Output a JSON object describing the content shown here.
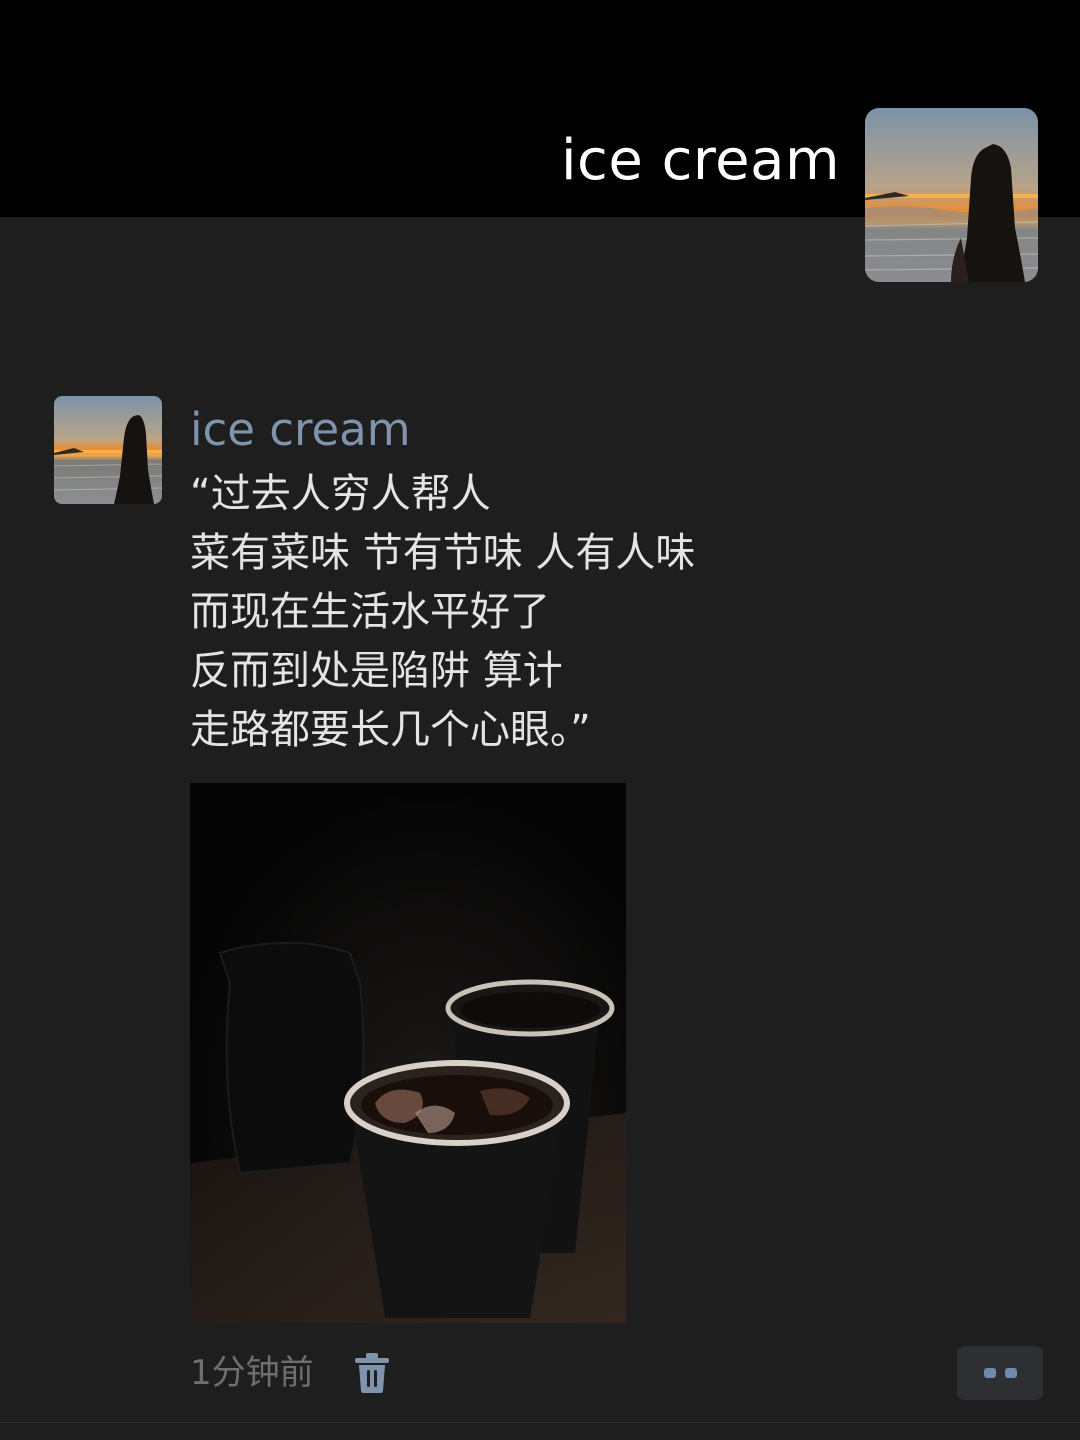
{
  "cover": {
    "display_name": "ice cream"
  },
  "post": {
    "author": "ice cream",
    "text_lines": [
      "“过去人穷人帮人",
      "菜有菜味 节有节味 人有人味",
      "而现在生活水平好了",
      "反而到处是陷阱 算计",
      "走路都要长几个心眼。”"
    ],
    "time": "1分钟前"
  },
  "icons": {
    "delete": "trash-icon",
    "more": "more-dots-icon"
  },
  "colors": {
    "name_link": "#7f93ad",
    "text": "#e4e4e4",
    "background": "#1e1e1e",
    "cover_background": "#000000"
  }
}
